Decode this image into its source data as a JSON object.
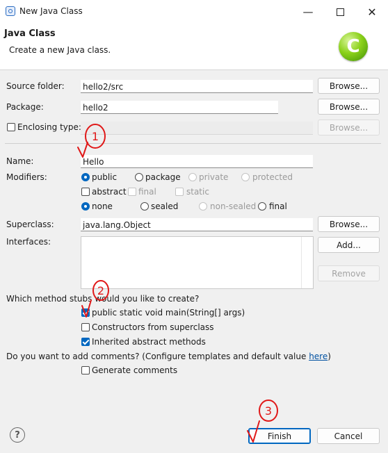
{
  "window": {
    "title": "New Java Class"
  },
  "header": {
    "title": "Java Class",
    "subtitle": "Create a new Java class.",
    "logo_letter": "C"
  },
  "form": {
    "source_folder": {
      "label": "Source folder:",
      "value": "hello2/src",
      "browse": "Browse..."
    },
    "package": {
      "label": "Package:",
      "value": "hello2",
      "browse": "Browse..."
    },
    "enclosing": {
      "label": "Enclosing type:",
      "checked": false,
      "value": "",
      "browse": "Browse..."
    },
    "name": {
      "label": "Name:",
      "value": "Hello"
    },
    "modifiers": {
      "label": "Modifiers:",
      "access": [
        "public",
        "package",
        "private",
        "protected"
      ],
      "access_selected": "public",
      "abstract": "abstract",
      "final": "final",
      "static": "static",
      "inheritance": [
        "none",
        "sealed",
        "non-sealed",
        "final"
      ],
      "inheritance_selected": "none"
    },
    "superclass": {
      "label": "Superclass:",
      "value": "java.lang.Object",
      "browse": "Browse..."
    },
    "interfaces": {
      "label": "Interfaces:",
      "add": "Add...",
      "remove": "Remove"
    }
  },
  "stubs": {
    "question": "Which method stubs would you like to create?",
    "items": [
      {
        "label": "public static void main(String[] args)",
        "checked": true
      },
      {
        "label": "Constructors from superclass",
        "checked": false
      },
      {
        "label": "Inherited abstract methods",
        "checked": true
      }
    ]
  },
  "comments": {
    "question_prefix": "Do you want to add comments? (Configure templates and default value ",
    "link": "here",
    "question_suffix": ")",
    "generate_label": "Generate comments",
    "generate_checked": false
  },
  "footer": {
    "help": "?",
    "finish": "Finish",
    "cancel": "Cancel"
  },
  "annotations": {
    "step1": "1",
    "step2": "2",
    "step3": "3",
    "color": "#e01818"
  },
  "icons": {
    "app": "eclipse-app-icon",
    "minimize": "minimize-icon",
    "maximize": "maximize-icon",
    "close": "close-icon",
    "logo": "new-class-logo-icon",
    "help": "help-icon"
  }
}
